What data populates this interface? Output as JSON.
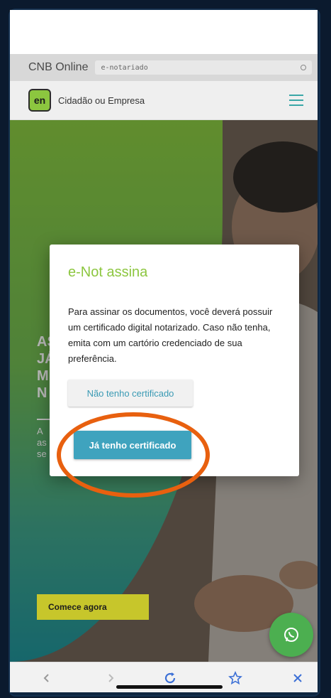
{
  "browser": {
    "app_name": "CNB Online",
    "url_text": "e-notariado"
  },
  "site": {
    "logo_text": "en",
    "label": "Cidadão ou Empresa"
  },
  "hero": {
    "heading_lines": [
      "AS",
      "JÁ",
      "M",
      "N"
    ],
    "sub_lines": [
      "A",
      "as",
      "se"
    ],
    "cta_label": "Comece agora"
  },
  "modal": {
    "title": "e-Not assina",
    "body": "Para assinar os documentos, você deverá possuir um certificado digital notarizado. Caso não tenha, emita com um cartório credenciado de sua preferência.",
    "secondary_button": "Não tenho certificado",
    "primary_button": "Já tenho certificado"
  },
  "colors": {
    "accent_green": "#8cc63f",
    "primary_button": "#3fa3be",
    "highlight_oval": "#e8600f",
    "whatsapp": "#4caf50"
  },
  "icons": {
    "hamburger": "menu-icon",
    "whatsapp": "whatsapp-icon",
    "back": "chevron-left-icon",
    "forward": "chevron-right-icon",
    "reload": "reload-icon",
    "bookmark": "star-icon",
    "close": "close-icon"
  }
}
